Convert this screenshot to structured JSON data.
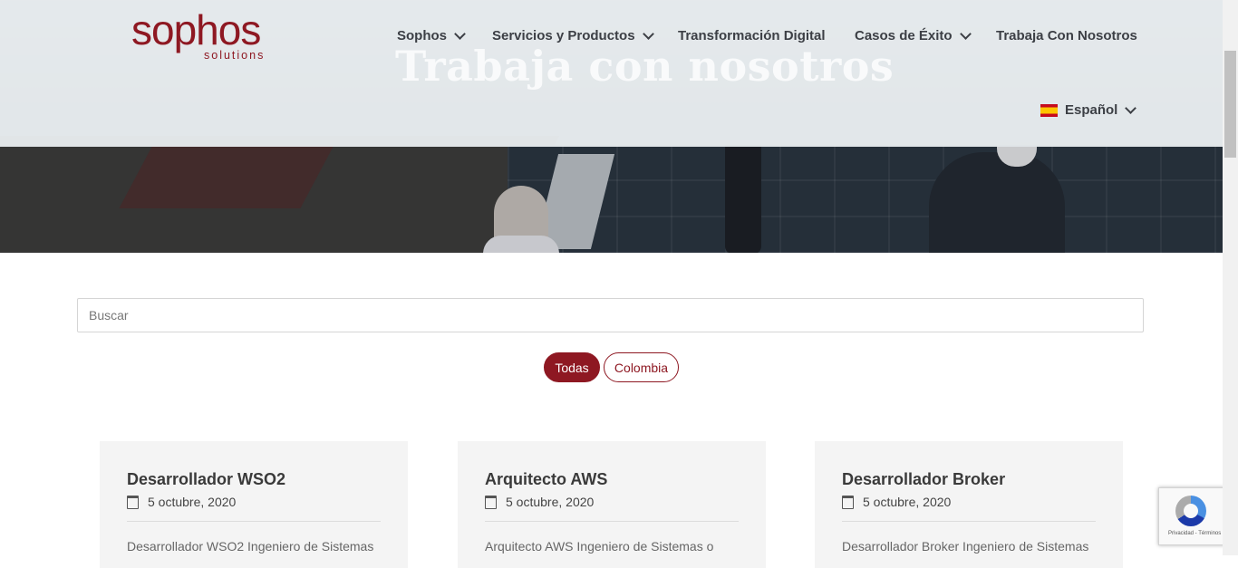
{
  "header": {
    "logo_word": "sophos",
    "logo_sub": "solutions",
    "nav": [
      {
        "label": "Sophos",
        "has_dropdown": true
      },
      {
        "label": "Servicios y Productos",
        "has_dropdown": true
      },
      {
        "label": "Transformación Digital",
        "has_dropdown": false
      },
      {
        "label": "Casos de Éxito",
        "has_dropdown": true
      },
      {
        "label": "Trabaja Con Nosotros",
        "has_dropdown": false
      }
    ],
    "language": {
      "label": "Español",
      "flag": "spain-flag-icon"
    }
  },
  "hero": {
    "title": "Trabaja con nosotros"
  },
  "search": {
    "placeholder": "Buscar",
    "value": ""
  },
  "filters": [
    {
      "label": "Todas",
      "active": true
    },
    {
      "label": "Colombia",
      "active": false
    }
  ],
  "jobs": [
    {
      "title": "Desarrollador WSO2",
      "date": "5 octubre, 2020",
      "excerpt": "Desarrollador WSO2 Ingeniero de Sistemas"
    },
    {
      "title": "Arquitecto AWS",
      "date": "5 octubre, 2020",
      "excerpt": "Arquitecto AWS Ingeniero de Sistemas o"
    },
    {
      "title": "Desarrollador Broker",
      "date": "5 octubre, 2020",
      "excerpt": "Desarrollador Broker Ingeniero de Sistemas"
    }
  ],
  "recaptcha": {
    "text": "Privacidad - Términos"
  },
  "colors": {
    "brand": "#8e1822",
    "nav_text": "#3c3f45",
    "card_bg": "#f4f4f4"
  }
}
